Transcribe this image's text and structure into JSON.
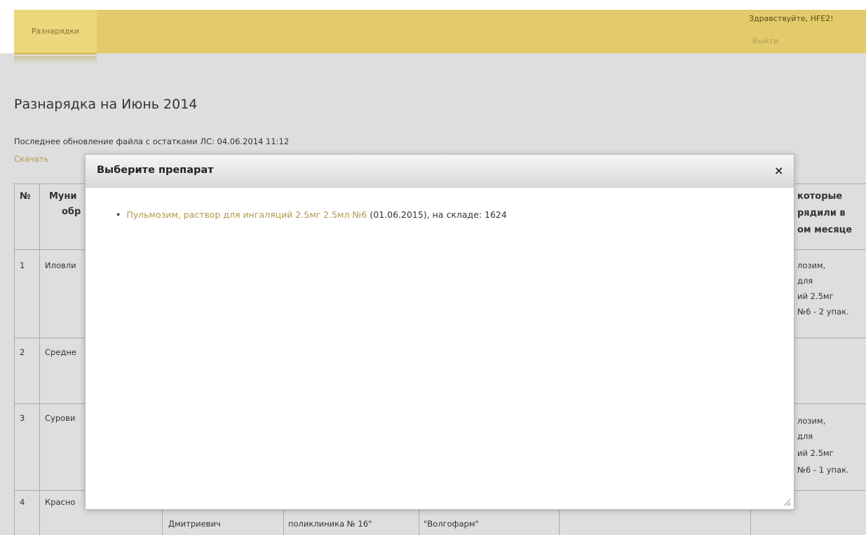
{
  "header": {
    "nav_tab_label": "Разнарядки",
    "greeting": "Здравствуйте, HFE2!",
    "logout_label": "Выйти"
  },
  "main": {
    "title": "Разнарядка на Июнь 2014",
    "last_update": "Последнее обновление файла с остатками ЛС: 04.06.2014 11:12",
    "download_label": "Скачать"
  },
  "table": {
    "headers": {
      "num": "№",
      "col2_part1": "Муни",
      "col2_part2": "обр",
      "last_line1": "которые",
      "last_line2": "рядили в",
      "last_line3": "ом месяце"
    },
    "rows": [
      {
        "num": "1",
        "name": "Иловли",
        "last": [
          "лозим,",
          "для",
          "ий 2.5мг",
          "№6 - 2 упак."
        ]
      },
      {
        "num": "2",
        "name": "Средне",
        "last": []
      },
      {
        "num": "3",
        "name": "Сурови",
        "last": [
          "лозим,",
          "для",
          "ий 2.5мг",
          "№6 - 1 упак."
        ]
      },
      {
        "num": "4",
        "name": "Красно",
        "last": []
      }
    ],
    "bottom_row": {
      "col3": "Дмитриевич",
      "col4": "поликлиника № 16\"",
      "col5": "\"Волгофарм\""
    }
  },
  "modal": {
    "title": "Выберите препарат",
    "close_symbol": "×",
    "item": {
      "bullet": "•",
      "link_text": "Пульмозим, раствор для ингаляций 2.5мг 2.5мл №6",
      "details": " (01.06.2015), на складе: 1624"
    }
  }
}
